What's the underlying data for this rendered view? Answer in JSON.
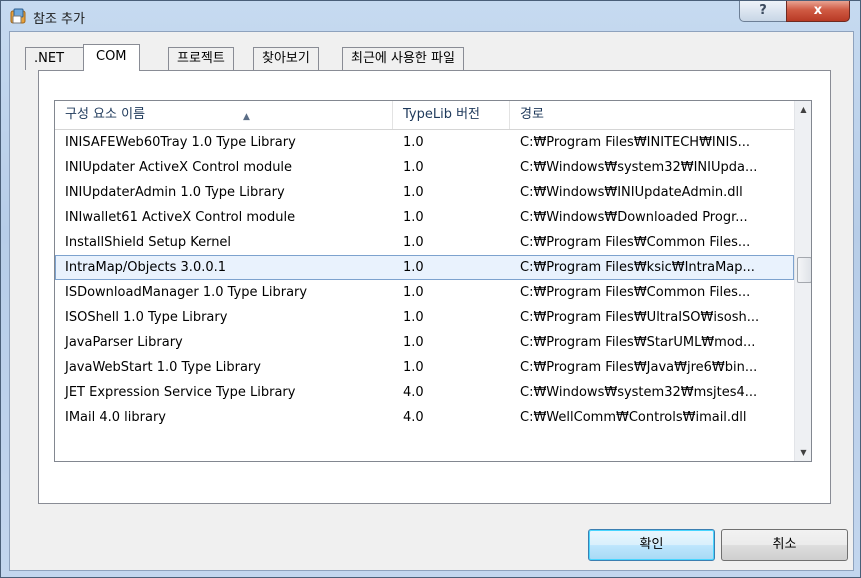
{
  "window": {
    "title": "참조 추가"
  },
  "titlebar": {
    "help_label": "?",
    "close_label": "x"
  },
  "tabs": [
    ".NET",
    "COM",
    "프로젝트",
    "찾아보기",
    "최근에 사용한 파일"
  ],
  "list": {
    "columns": [
      "구성 요소 이름",
      "TypeLib 버전",
      "경로"
    ],
    "rows": [
      {
        "name": "INISAFEWeb60Tray 1.0 Type Library",
        "version": "1.0",
        "path": "C:₩Program Files₩INITECH₩INIS..."
      },
      {
        "name": "INIUpdater ActiveX Control module",
        "version": "1.0",
        "path": "C:₩Windows₩system32₩INIUpda..."
      },
      {
        "name": "INIUpdaterAdmin 1.0 Type Library",
        "version": "1.0",
        "path": "C:₩Windows₩INIUpdateAdmin.dll"
      },
      {
        "name": "INIwallet61 ActiveX Control module",
        "version": "1.0",
        "path": "C:₩Windows₩Downloaded Progr..."
      },
      {
        "name": "InstallShield Setup Kernel",
        "version": "1.0",
        "path": "C:₩Program Files₩Common Files..."
      },
      {
        "name": "IntraMap/Objects 3.0.0.1",
        "version": "1.0",
        "path": "C:₩Program Files₩ksic₩IntraMap..."
      },
      {
        "name": "ISDownloadManager 1.0 Type Library",
        "version": "1.0",
        "path": "C:₩Program Files₩Common Files..."
      },
      {
        "name": "ISOShell 1.0 Type Library",
        "version": "1.0",
        "path": "C:₩Program Files₩UltraISO₩isosh..."
      },
      {
        "name": "JavaParser Library",
        "version": "1.0",
        "path": "C:₩Program Files₩StarUML₩mod..."
      },
      {
        "name": "JavaWebStart 1.0 Type Library",
        "version": "1.0",
        "path": "C:₩Program Files₩Java₩jre6₩bin..."
      },
      {
        "name": "JET Expression Service Type Library",
        "version": "4.0",
        "path": "C:₩Windows₩system32₩msjtes4..."
      },
      {
        "name": "IMail 4.0 library",
        "version": "4.0",
        "path": "C:₩WellComm₩Controls₩imail.dll"
      }
    ]
  },
  "buttons": {
    "ok": "확인",
    "cancel": "취소"
  }
}
